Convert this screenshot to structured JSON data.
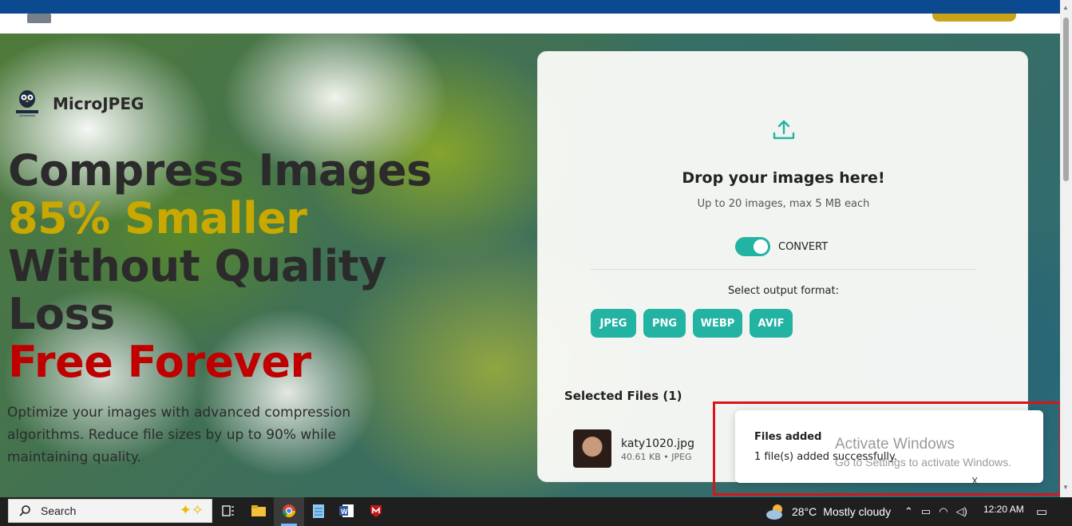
{
  "site": {
    "brand": "MicroJPEG",
    "headline": {
      "line1": "Compress Images",
      "line2": "85% Smaller",
      "line3": "Without Quality",
      "line4": "Loss",
      "line5": "Free Forever"
    },
    "subtext": "Optimize your images with advanced compression algorithms. Reduce file sizes by up to 90% while maintaining quality."
  },
  "upload": {
    "title": "Drop your images here!",
    "subtitle": "Up to 20 images, max 5 MB each",
    "convert_label": "CONVERT",
    "convert_on": true,
    "format_label": "Select output format:",
    "formats": [
      "JPEG",
      "PNG",
      "WEBP",
      "AVIF"
    ],
    "selected_files_title": "Selected Files (1)",
    "files": [
      {
        "name": "katy1020.jpg",
        "meta": "40.61 KB • JPEG"
      }
    ]
  },
  "toast": {
    "title": "Files added",
    "message": "1 file(s) added successfully.",
    "close": "X"
  },
  "watermark": {
    "line1": "Activate Windows",
    "line2": "Go to Settings to activate Windows."
  },
  "taskbar": {
    "search_label": "Search",
    "weather_temp": "28°C",
    "weather_desc": "Mostly cloudy",
    "time": "12:20 AM"
  },
  "colors": {
    "accent_teal": "#22b3a3",
    "gold": "#c9a800",
    "red": "#c00000",
    "highlight_red": "#d8141c"
  }
}
